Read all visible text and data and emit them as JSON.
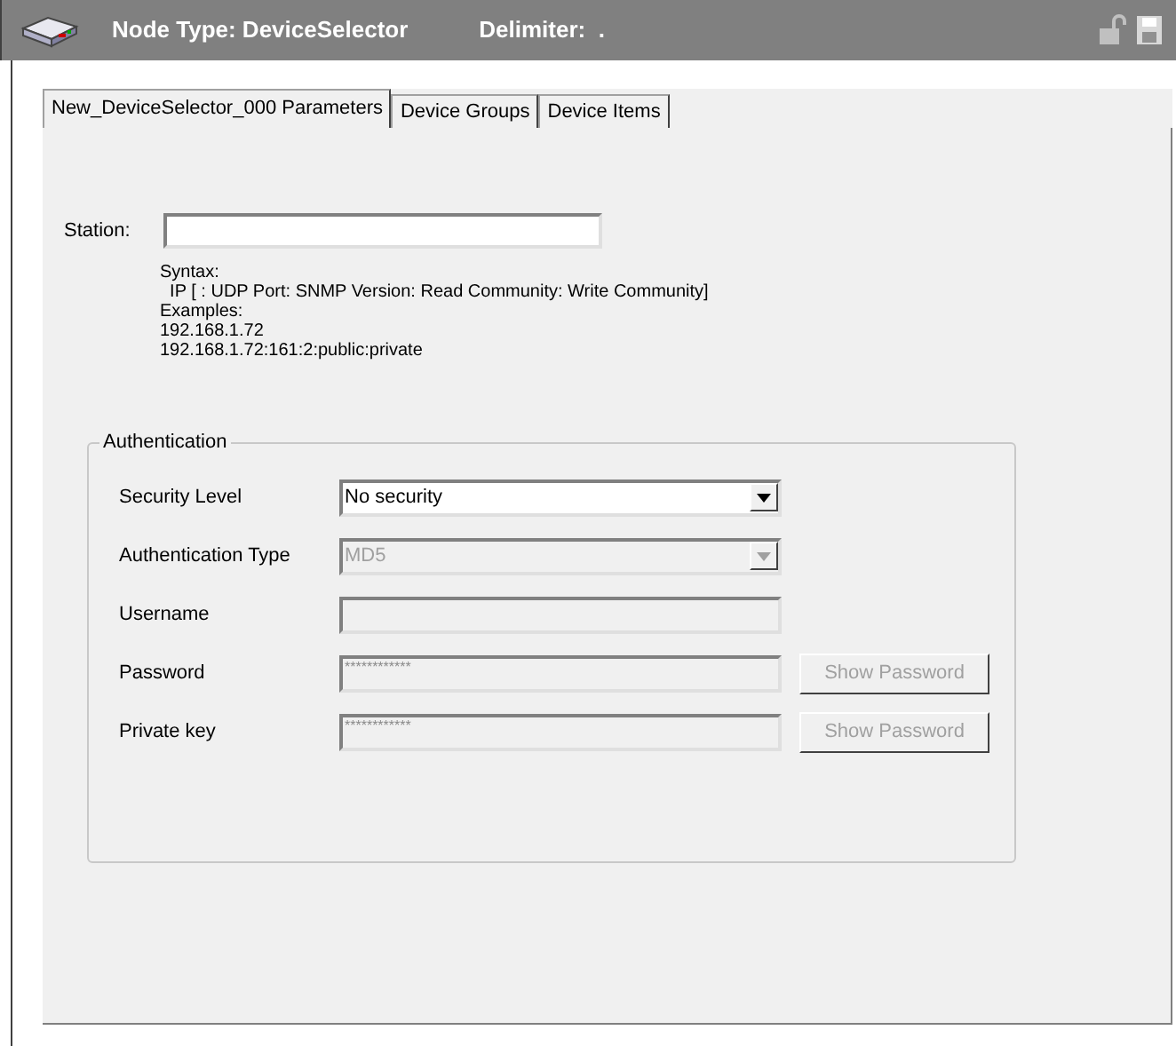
{
  "header": {
    "node_type": "Node Type: DeviceSelector",
    "delimiter": "Delimiter:  ."
  },
  "tabs": [
    {
      "label": "New_DeviceSelector_000 Parameters",
      "selected": true
    },
    {
      "label": "Device Groups",
      "selected": false
    },
    {
      "label": "Device Items",
      "selected": false
    }
  ],
  "station": {
    "label": "Station:"
  },
  "help_lines": [
    "Syntax:",
    "  IP [ : UDP Port: SNMP Version: Read Community: Write Community]",
    "Examples:",
    "192.168.1.72",
    "192.168.1.72:161:2:public:private"
  ],
  "authentication": {
    "title": "Authentication",
    "rows": [
      {
        "kind": "select",
        "label": "Security Level",
        "value": "No security",
        "disabled": false
      },
      {
        "kind": "select",
        "label": "Authentication Type",
        "value": "MD5",
        "disabled": true
      },
      {
        "kind": "text",
        "label": "Username",
        "disabled": true
      },
      {
        "kind": "password",
        "label": "Password",
        "value": "************",
        "disabled": true,
        "button": "Show Password"
      },
      {
        "kind": "password",
        "label": "Private key",
        "value": "************",
        "disabled": true,
        "button": "Show Password"
      }
    ]
  }
}
